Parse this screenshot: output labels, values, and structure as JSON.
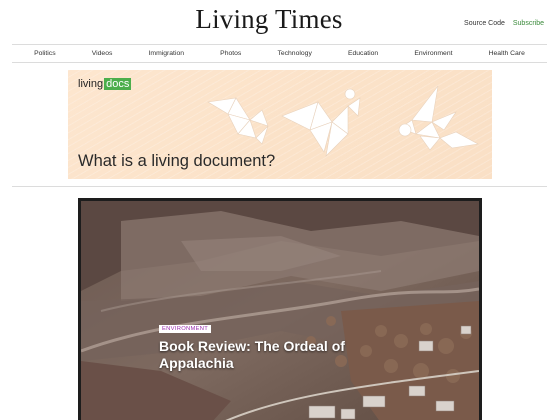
{
  "header": {
    "site_title": "Living Times",
    "source_code_label": "Source Code",
    "subscribe_label": "Subscribe"
  },
  "nav": {
    "items": [
      "Politics",
      "Videos",
      "Immigration",
      "Photos",
      "Technology",
      "Education",
      "Environment",
      "Health Care"
    ]
  },
  "promo": {
    "logo_prefix": "living",
    "logo_suffix": "docs",
    "title": "What is a living document?",
    "background_color": "#fbe2c8",
    "logo_accent_color": "#4cae4c"
  },
  "feature": {
    "category_label": "ENVIRONMENT",
    "category_color": "#9b2fae",
    "title": "Book Review: The Ordeal of Appalachia"
  }
}
